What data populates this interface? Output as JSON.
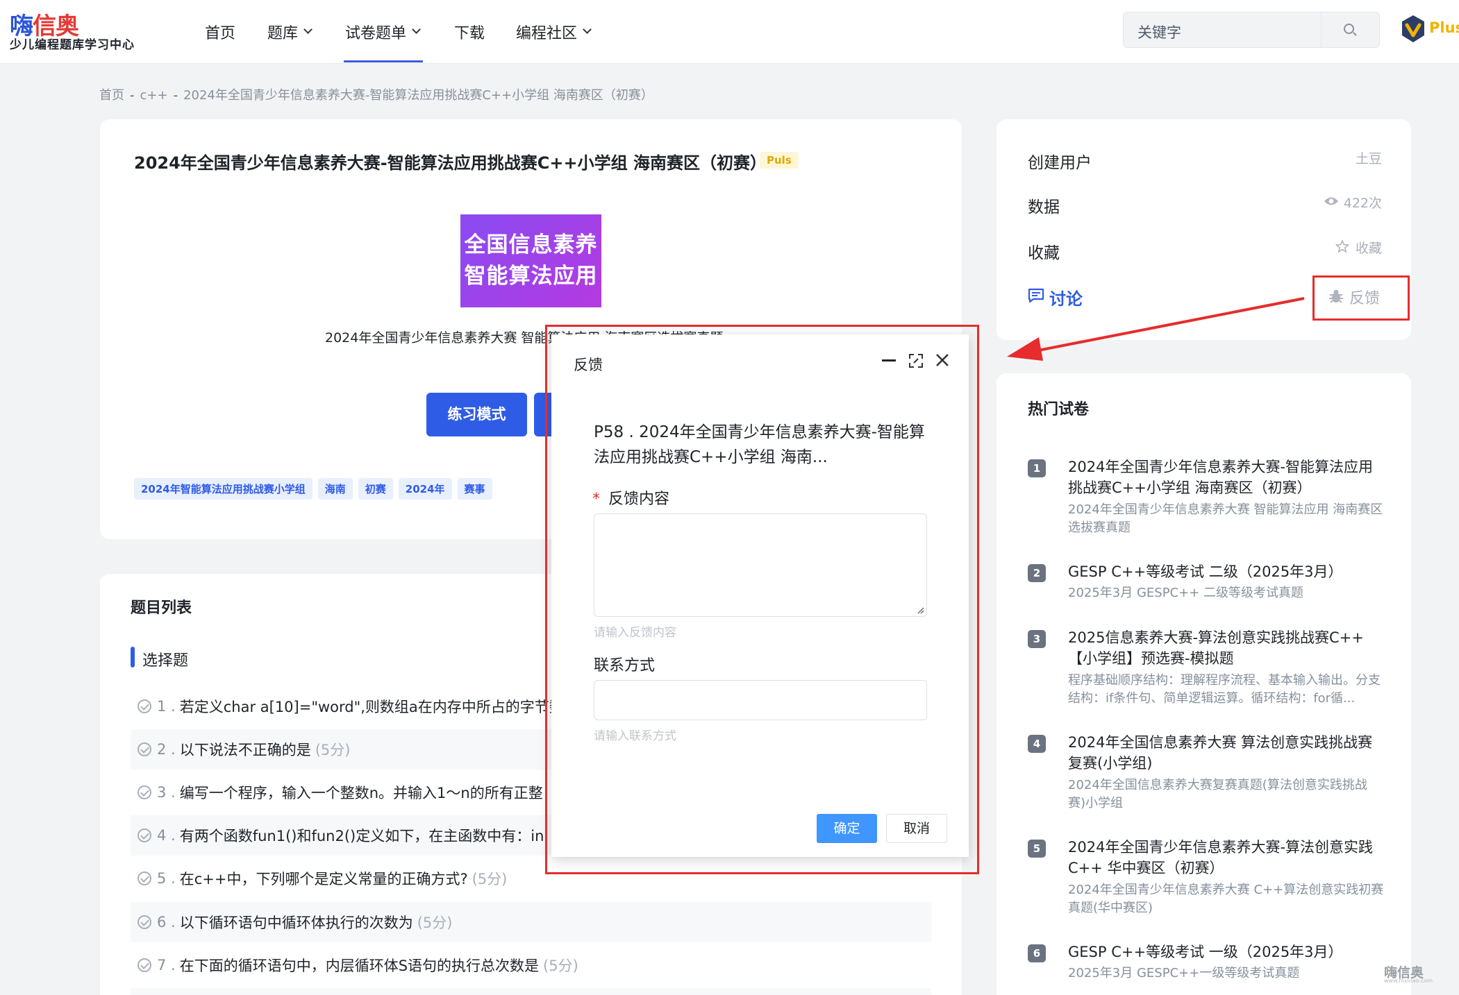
{
  "nav": {
    "logo_title_a": "嗨",
    "logo_title_b": "信奥",
    "logo_subtitle": "少儿编程题库学习中心",
    "menu": [
      {
        "label": "首页"
      },
      {
        "label": "题库"
      },
      {
        "label": "试卷题单"
      },
      {
        "label": "下载"
      },
      {
        "label": "编程社区"
      }
    ],
    "search_placeholder": "关键字",
    "plus_label": "Plus"
  },
  "breadcrumb": [
    "首页",
    "c++",
    "2024年全国青少年信息素养大赛-智能算法应用挑战赛C++小学组 海南赛区（初赛）"
  ],
  "breadcrumb_sep": "-",
  "paper": {
    "title": "2024年全国青少年信息素养大赛-智能算法应用挑战赛C++小学组 海南赛区（初赛）",
    "badge": "Puls",
    "banner_line1": "全国信息素养",
    "banner_line2": "智能算法应用",
    "description": "2024年全国青少年信息素养大赛  智能算法应用  海南赛区选拔赛真题",
    "practice_button": "练习模式",
    "tags": [
      "2024年智能算法应用挑战赛小学组",
      "海南",
      "初赛",
      "2024年",
      "赛事"
    ]
  },
  "question_list": {
    "title": "题目列表",
    "type": "选择题",
    "items": [
      {
        "num": "1 .",
        "text": "若定义char a[10]=\"word\",则数组a在内存中所占的字节数",
        "pts": ""
      },
      {
        "num": "2 .",
        "text": "以下说法不正确的是",
        "pts": "(5分)"
      },
      {
        "num": "3 .",
        "text": "编写一个程序，输入一个整数n。并输入1～n的所有正整",
        "pts": ""
      },
      {
        "num": "4 .",
        "text": "有两个函数fun1()和fun2()定义如下，在主函数中有：in",
        "pts": ""
      },
      {
        "num": "5 .",
        "text": "在c++中，下列哪个是定义常量的正确方式?",
        "pts": "(5分)"
      },
      {
        "num": "6 .",
        "text": "以下循环语句中循环体执行的次数为",
        "pts": "(5分)"
      },
      {
        "num": "7 .",
        "text": "在下面的循环语句中，内层循环体S语句的执行总次数是",
        "pts": "(5分)"
      }
    ]
  },
  "sidebar": {
    "creator_label": "创建用户",
    "creator_value": "土豆",
    "data_label": "数据",
    "data_value": "422次",
    "fav_label": "收藏",
    "fav_value": "收藏",
    "discuss_label": "讨论",
    "feedback_label": "反馈"
  },
  "hot": {
    "title": "热门试卷",
    "items": [
      {
        "num": "1",
        "name": "2024年全国青少年信息素养大赛-智能算法应用挑战赛C++小学组 海南赛区（初赛）",
        "sub": "2024年全国青少年信息素养大赛 智能算法应用 海南赛区选拔赛真题"
      },
      {
        "num": "2",
        "name": "GESP C++等级考试 二级（2025年3月）",
        "sub": "2025年3月 GESPC++ 二级等级考试真题"
      },
      {
        "num": "3",
        "name": "2025信息素养大赛-算法创意实践挑战赛C++【小学组】预选赛-模拟题",
        "sub": "程序基础顺序结构：理解程序流程、基本输入输出。分支结构：if条件句、简单逻辑运算。循环结构：for循..."
      },
      {
        "num": "4",
        "name": "2024年全国信息素养大赛 算法创意实践挑战赛复赛(小学组)",
        "sub": "2024年全国信息素养大赛复赛真题(算法创意实践挑战赛)小学组"
      },
      {
        "num": "5",
        "name": "2024年全国青少年信息素养大赛-算法创意实践C++ 华中赛区（初赛）",
        "sub": "2024年全国青少年信息素养大赛 C++算法创意实践初赛真题(华中赛区)"
      },
      {
        "num": "6",
        "name": "GESP C++等级考试 一级（2025年3月）",
        "sub": "2025年3月 GESPC++一级等级考试真题"
      }
    ]
  },
  "dialog": {
    "title": "反馈",
    "question": "P58 . 2024年全国青少年信息素养大赛-智能算法应用挑战赛C++小学组 海南...",
    "required_mark": "*",
    "content_label": "反馈内容",
    "content_hint": "请输入反馈内容",
    "contact_label": "联系方式",
    "contact_hint": "请输入联系方式",
    "ok_label": "确定",
    "cancel_label": "取消"
  },
  "watermark": {
    "text": "嗨信奥",
    "url": "www.hixinao.com"
  },
  "colors": {
    "accent": "#2f5ce6",
    "annotation": "#e62c2c",
    "plus": "#f0b400"
  }
}
